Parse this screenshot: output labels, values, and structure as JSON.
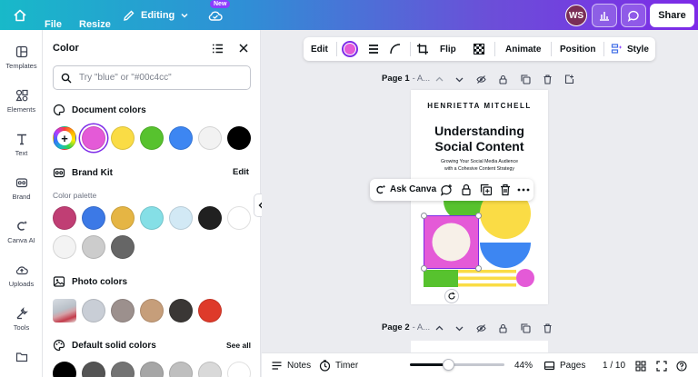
{
  "topbar": {
    "file_label": "File",
    "resize_label": "Resize",
    "editing_label": "Editing",
    "new_badge": "New",
    "avatar_initials": "WS",
    "share_label": "Share"
  },
  "rail": {
    "items": [
      {
        "label": "Templates",
        "icon": "templates-icon"
      },
      {
        "label": "Elements",
        "icon": "elements-icon"
      },
      {
        "label": "Text",
        "icon": "text-icon"
      },
      {
        "label": "Brand",
        "icon": "brand-icon"
      },
      {
        "label": "Canva AI",
        "icon": "canva-ai-icon"
      },
      {
        "label": "Uploads",
        "icon": "uploads-icon"
      },
      {
        "label": "Tools",
        "icon": "tools-icon"
      }
    ]
  },
  "panel": {
    "title": "Color",
    "search_placeholder": "Try \"blue\" or \"#00c4cc\"",
    "document_colors_label": "Document colors",
    "document_colors": [
      "#e45ad7",
      "#fadc45",
      "#57c22e",
      "#3d86f2",
      "#f2f2f2",
      "#000000"
    ],
    "brand_kit_label": "Brand Kit",
    "brand_kit_edit": "Edit",
    "palette_label": "Color palette",
    "palette": [
      "#c03e74",
      "#3c79e6",
      "#e5b544",
      "#85dfe6",
      "#d2e9f5",
      "#202020",
      "#ffffff",
      "#f3f3f3",
      "#cccccc",
      "#666666"
    ],
    "photo_colors_label": "Photo colors",
    "photo_colors": [
      "#c9ced6",
      "#9c908d",
      "#c69e7a",
      "#3a3735",
      "#de3a2a"
    ],
    "default_solid_label": "Default solid colors",
    "see_all": "See all",
    "default_solid": [
      "#000000",
      "#545454",
      "#737373",
      "#a6a6a6",
      "#bfbfbf",
      "#d9d9d9",
      "#ffffff"
    ]
  },
  "context_toolbar": {
    "edit": "Edit",
    "flip": "Flip",
    "animate": "Animate",
    "position": "Position",
    "style": "Style",
    "fill_color": "#e45ad7"
  },
  "pages": {
    "page1_label": "Page 1",
    "page1_title_placeholder": "- A...",
    "page2_label": "Page 2",
    "page2_title_placeholder": "- A..."
  },
  "design": {
    "author": "HENRIETTA MITCHELL",
    "title_line1": "Understanding",
    "title_line2": "Social Content",
    "subtitle_line1": "Growing Your Social Media Audience",
    "subtitle_line2": "with a Cohesive Content Strategy"
  },
  "ask_canva": {
    "label": "Ask Canva"
  },
  "bottom": {
    "notes": "Notes",
    "timer": "Timer",
    "zoom": "44%",
    "pages": "Pages",
    "page_count": "1 / 10",
    "zoom_fraction": 0.4
  }
}
